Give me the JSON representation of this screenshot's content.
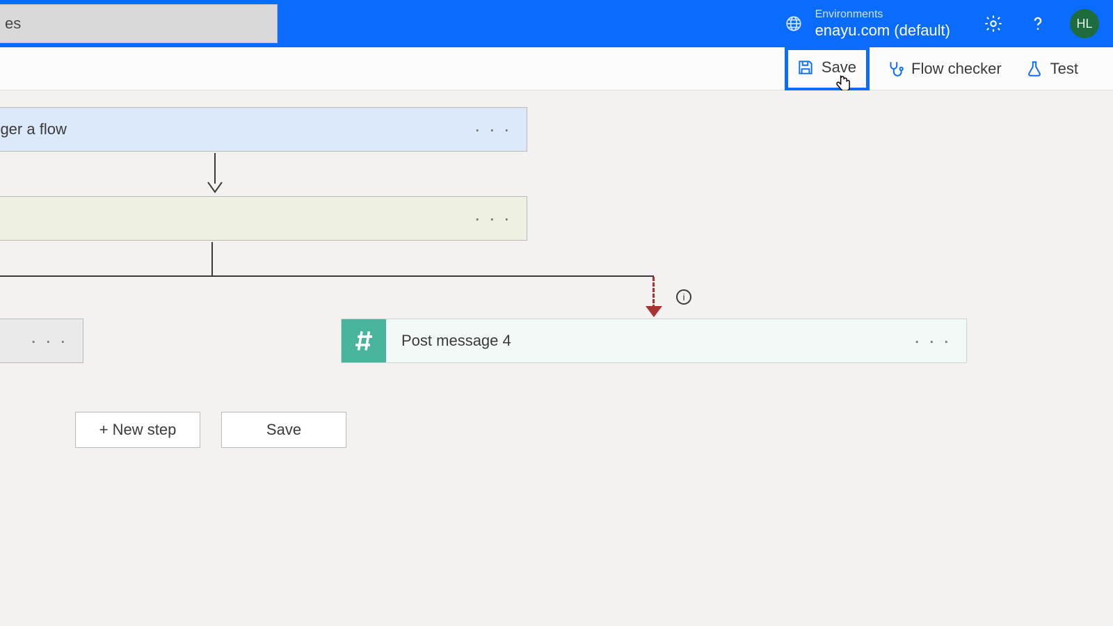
{
  "topbar": {
    "search_text": "es",
    "env_label": "Environments",
    "env_name": "enayu.com (default)",
    "avatar_initials": "HL"
  },
  "cmdbar": {
    "save": "Save",
    "flow_checker": "Flow checker",
    "test": "Test"
  },
  "flow": {
    "trigger_title": "lly trigger a flow",
    "post_message_title": "Post message 4",
    "info_char": "i"
  },
  "actions": {
    "new_step": "+ New step",
    "save": "Save"
  }
}
